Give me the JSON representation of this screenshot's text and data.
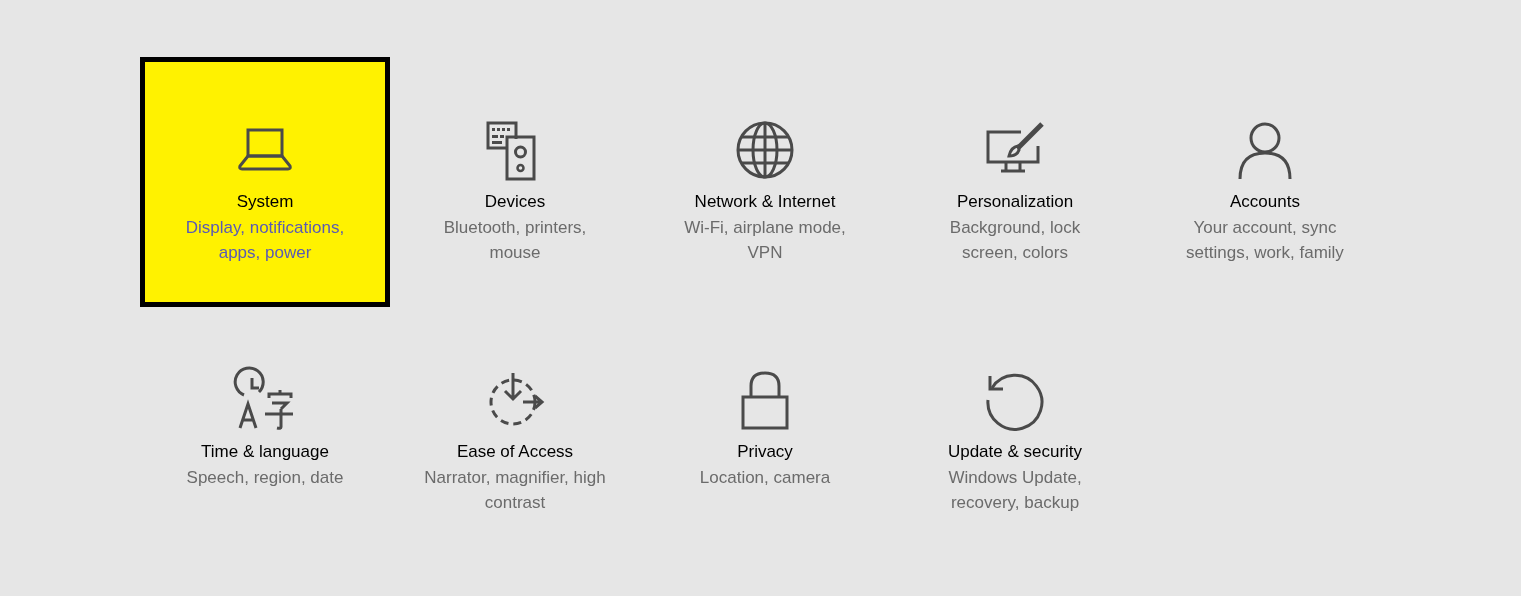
{
  "tiles": [
    {
      "kind": "laptop",
      "title": "System",
      "description": "Display, notifications, apps, power",
      "selected": true
    },
    {
      "kind": "devices",
      "title": "Devices",
      "description": "Bluetooth, printers, mouse",
      "selected": false
    },
    {
      "kind": "globe",
      "title": "Network & Internet",
      "description": "Wi-Fi, airplane mode, VPN",
      "selected": false
    },
    {
      "kind": "paint",
      "title": "Personalization",
      "description": "Background, lock screen, colors",
      "selected": false
    },
    {
      "kind": "person",
      "title": "Accounts",
      "description": "Your account, sync settings, work, family",
      "selected": false
    },
    {
      "kind": "language",
      "title": "Time & language",
      "description": "Speech, region, date",
      "selected": false
    },
    {
      "kind": "ease",
      "title": "Ease of Access",
      "description": "Narrator, magnifier, high contrast",
      "selected": false
    },
    {
      "kind": "lock",
      "title": "Privacy",
      "description": "Location, camera",
      "selected": false
    },
    {
      "kind": "update",
      "title": "Update & security",
      "description": "Windows Update, recovery, backup",
      "selected": false
    }
  ]
}
